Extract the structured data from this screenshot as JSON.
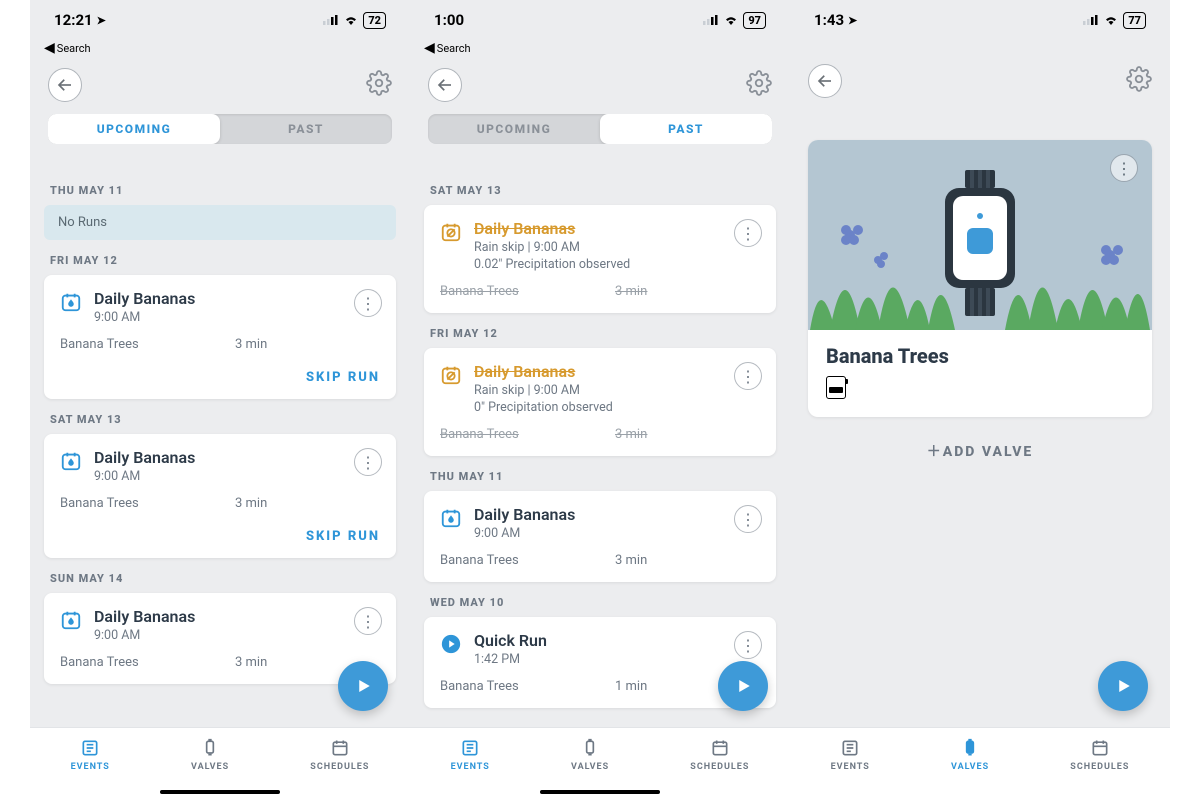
{
  "icons": {
    "arrow_left": "←",
    "kebab": "⋮",
    "plus": "＋",
    "location": "➤"
  },
  "tabs": {
    "events": "EVENTS",
    "valves": "VALVES",
    "schedules": "SCHEDULES"
  },
  "segments": {
    "upcoming": "UPCOMING",
    "past": "PAST"
  },
  "back_search": "Search",
  "phone1": {
    "time": "12:21",
    "battery": "72",
    "day1": {
      "hdr": "THU MAY 11",
      "noruns": "No Runs"
    },
    "day2": {
      "hdr": "FRI MAY 12",
      "card": {
        "title": "Daily Bananas",
        "time": "9:00 AM",
        "zone": "Banana Trees",
        "dur": "3 min",
        "skip": "SKIP RUN"
      }
    },
    "day3": {
      "hdr": "SAT MAY 13",
      "card": {
        "title": "Daily Bananas",
        "time": "9:00 AM",
        "zone": "Banana Trees",
        "dur": "3 min",
        "skip": "SKIP RUN"
      }
    },
    "day4": {
      "hdr": "SUN MAY 14",
      "card": {
        "title": "Daily Bananas",
        "time": "9:00 AM",
        "zone": "Banana Trees",
        "dur": "3 min"
      }
    }
  },
  "phone2": {
    "time": "1:00",
    "battery": "97",
    "day1": {
      "hdr": "SAT MAY 13",
      "card": {
        "title": "Daily Bananas",
        "sub": "Rain skip | 9:00 AM",
        "sub2": "0.02\" Precipitation observed",
        "zone": "Banana Trees",
        "dur": "3 min"
      }
    },
    "day2": {
      "hdr": "FRI MAY 12",
      "card": {
        "title": "Daily Bananas",
        "sub": "Rain skip | 9:00 AM",
        "sub2": "0\" Precipitation observed",
        "zone": "Banana Trees",
        "dur": "3 min"
      }
    },
    "day3": {
      "hdr": "THU MAY 11",
      "card": {
        "title": "Daily Bananas",
        "time": "9:00 AM",
        "zone": "Banana Trees",
        "dur": "3 min"
      }
    },
    "day4": {
      "hdr": "WED MAY 10",
      "card": {
        "title": "Quick Run",
        "time": "1:42 PM",
        "zone": "Banana Trees",
        "dur": "1 min"
      }
    }
  },
  "phone3": {
    "time": "1:43",
    "battery": "77",
    "valve_title": "Banana Trees",
    "add_valve": "ADD VALVE"
  }
}
